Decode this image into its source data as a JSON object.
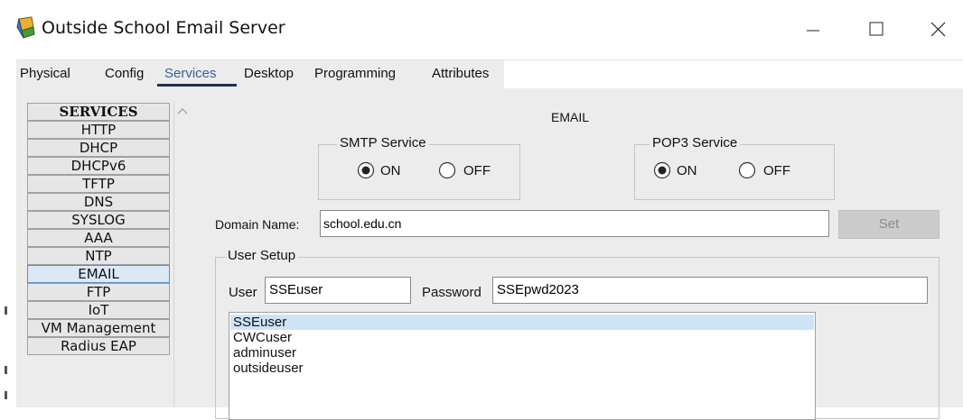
{
  "window": {
    "title": "Outside School Email Server",
    "icon": "packet-tracer-server-icon"
  },
  "tabs": [
    {
      "label": "Physical"
    },
    {
      "label": "Config"
    },
    {
      "label": "Services",
      "active": true
    },
    {
      "label": "Desktop"
    },
    {
      "label": "Programming"
    },
    {
      "label": "Attributes"
    }
  ],
  "sidebar": {
    "header": "SERVICES",
    "items": [
      {
        "label": "HTTP"
      },
      {
        "label": "DHCP"
      },
      {
        "label": "DHCPv6"
      },
      {
        "label": "TFTP"
      },
      {
        "label": "DNS"
      },
      {
        "label": "SYSLOG"
      },
      {
        "label": "AAA"
      },
      {
        "label": "NTP"
      },
      {
        "label": "EMAIL",
        "selected": true
      },
      {
        "label": "FTP"
      },
      {
        "label": "IoT"
      },
      {
        "label": "VM Management"
      },
      {
        "label": "Radius EAP"
      }
    ]
  },
  "email": {
    "title": "EMAIL",
    "smtp": {
      "legend": "SMTP Service",
      "on_label": "ON",
      "off_label": "OFF",
      "selected": "ON"
    },
    "pop3": {
      "legend": "POP3 Service",
      "on_label": "ON",
      "off_label": "OFF",
      "selected": "ON"
    },
    "domain_label": "Domain Name:",
    "domain_value": "school.edu.cn",
    "set_button": "Set",
    "user_setup": {
      "legend": "User Setup",
      "user_label": "User",
      "user_value": "SSEuser",
      "password_label": "Password",
      "password_value": "SSEpwd2023",
      "users": [
        "SSEuser",
        "CWCuser",
        "adminuser",
        "outsideuser"
      ],
      "selected_user": "SSEuser"
    }
  },
  "colors": {
    "panel_bg": "#ececec",
    "selection": "#cfe3f7",
    "tab_active_underline": "#1f2f52"
  }
}
